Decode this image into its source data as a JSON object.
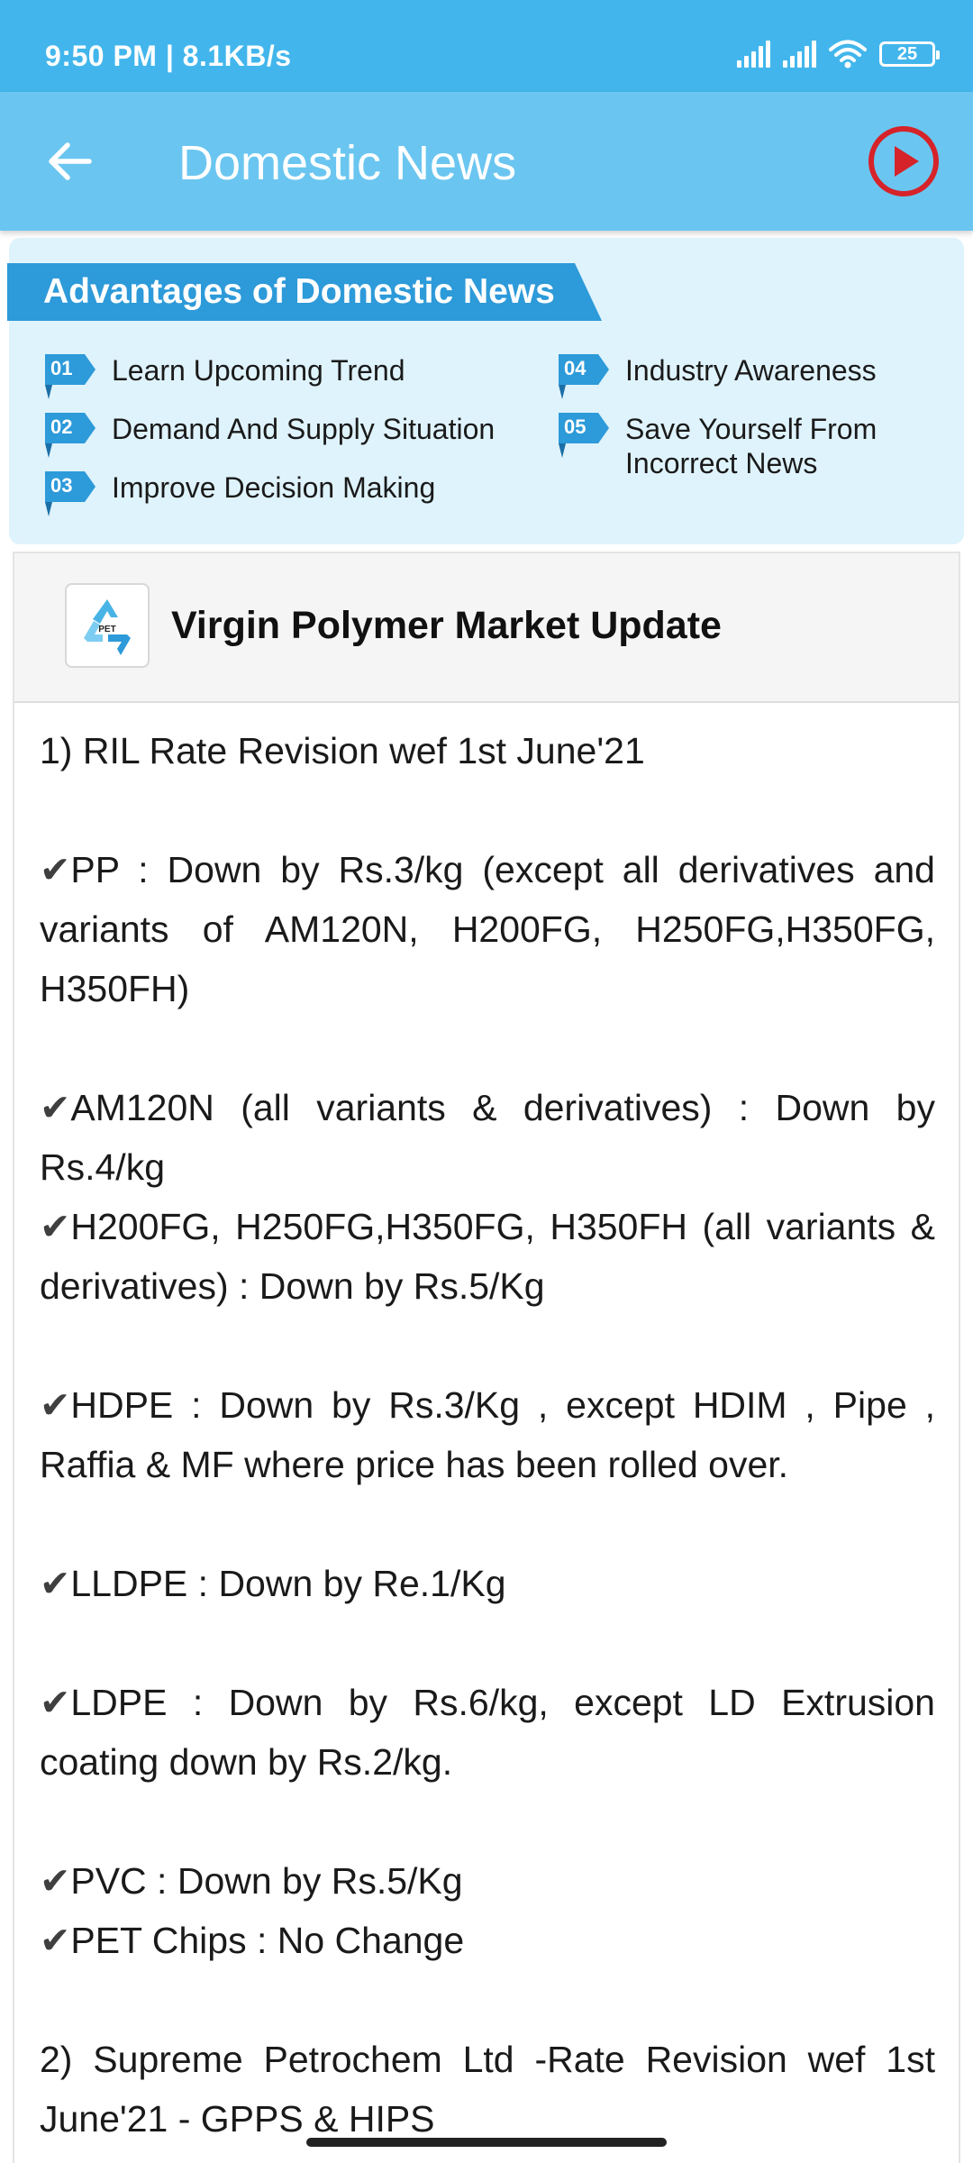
{
  "status_bar": {
    "time_speed": "9:50 PM | 8.1KB/s",
    "battery_level": "25",
    "icons": [
      "signal-icon",
      "signal-icon",
      "wifi-icon",
      "battery-icon"
    ]
  },
  "app_bar": {
    "title": "Domestic News",
    "back_icon": "arrow-left-icon",
    "play_icon": "play-circle-icon",
    "colors": {
      "status": "#42b6ec",
      "bar": "#6ac6f0",
      "play": "#d6232a"
    }
  },
  "advantages": {
    "heading": "Advantages of Domestic News",
    "items": [
      {
        "num": "01",
        "label": "Learn Upcoming Trend"
      },
      {
        "num": "02",
        "label": "Demand And Supply Situation"
      },
      {
        "num": "03",
        "label": "Improve Decision Making"
      },
      {
        "num": "04",
        "label": "Industry Awareness"
      },
      {
        "num": "05",
        "label": "Save Yourself From Incorrect News"
      }
    ]
  },
  "news": {
    "logo_text": "PET",
    "title": "Virgin Polymer Market Update",
    "check_glyph": "✔",
    "body": {
      "p1": "1) RIL Rate Revision wef 1st June'21",
      "p2": "PP : Down by Rs.3/kg (except all derivatives and variants of AM120N, H200FG, H250FG,H350FG, H350FH)",
      "p3": "AM120N (all variants & derivatives) : Down by Rs.4/kg",
      "p4": "H200FG, H250FG,H350FG, H350FH (all variants & derivatives) : Down by Rs.5/Kg",
      "p5": "HDPE : Down by Rs.3/Kg , except HDIM , Pipe , Raffia & MF where price has been rolled over.",
      "p6": "LLDPE : Down by Re.1/Kg",
      "p7": "LDPE : Down by Rs.6/kg, except LD Extrusion coating down by Rs.2/kg.",
      "p8": "PVC : Down by Rs.5/Kg",
      "p9": "PET Chips : No Change",
      "p10": "2) Supreme Petrochem Ltd -Rate Revision wef 1st June'21 - GPPS & HIPS"
    }
  }
}
